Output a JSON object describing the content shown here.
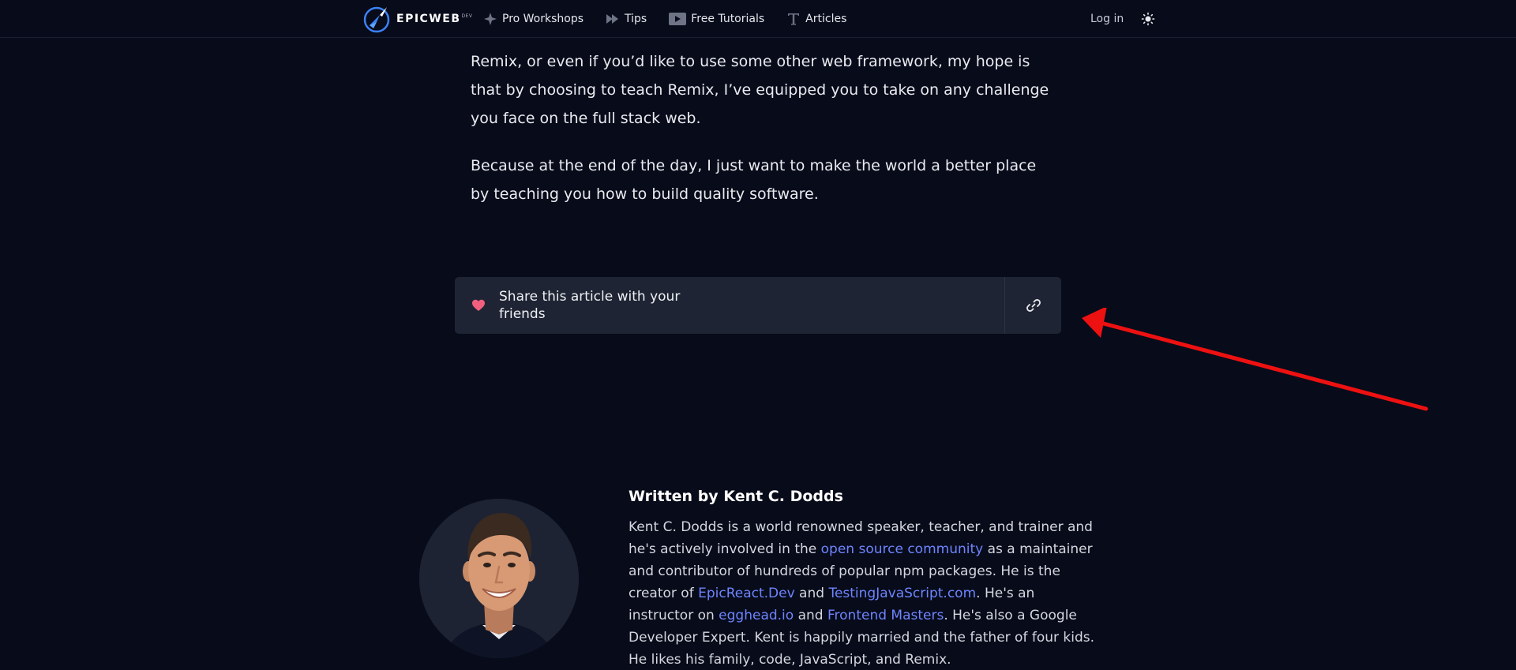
{
  "header": {
    "logo_text": "EPICWEB",
    "logo_sup": "DEV",
    "nav": [
      {
        "label": "Pro Workshops",
        "icon": "workshops-icon"
      },
      {
        "label": "Tips",
        "icon": "tips-icon"
      },
      {
        "label": "Free Tutorials",
        "icon": "tutorials-icon"
      },
      {
        "label": "Articles",
        "icon": "articles-icon"
      }
    ],
    "login": "Log in",
    "theme_icon": "sun-icon"
  },
  "article": {
    "paragraph_1": "Remix, or even if you’d like to use some other web framework, my hope is that by choosing to teach Remix, I’ve equipped you to take on any challenge you face on the full stack web.",
    "paragraph_2": "Because at the end of the day, I just want to make the world a better place by teaching you how to build quality software."
  },
  "share": {
    "text": "Share this article with your friends",
    "heart_icon": "heart-icon",
    "link_icon": "link-icon"
  },
  "author": {
    "title": "Written by Kent C. Dodds",
    "bio_1": "Kent C. Dodds is a world renowned speaker, teacher, and trainer and he's actively involved in the ",
    "link_oss": "open source community",
    "bio_2": " as a maintainer and contributor of hundreds of popular npm packages. He is the creator of ",
    "link_epicreact": "EpicReact.Dev",
    "bio_3": " and ",
    "link_testingjs": "TestingJavaScript.com",
    "bio_4": ". He's an instructor on ",
    "link_egghead": "egghead.io",
    "bio_5": " and ",
    "link_fem": "Frontend Masters",
    "bio_6": ". He's also a Google Developer Expert. Kent is happily married and the father of four kids. He likes his family, code, JavaScript, and Remix."
  },
  "colors": {
    "background": "#080b1a",
    "panel": "#1e2433",
    "link": "#6d85ff",
    "heart": "#f0607e",
    "annotation_arrow": "#ee1111"
  }
}
